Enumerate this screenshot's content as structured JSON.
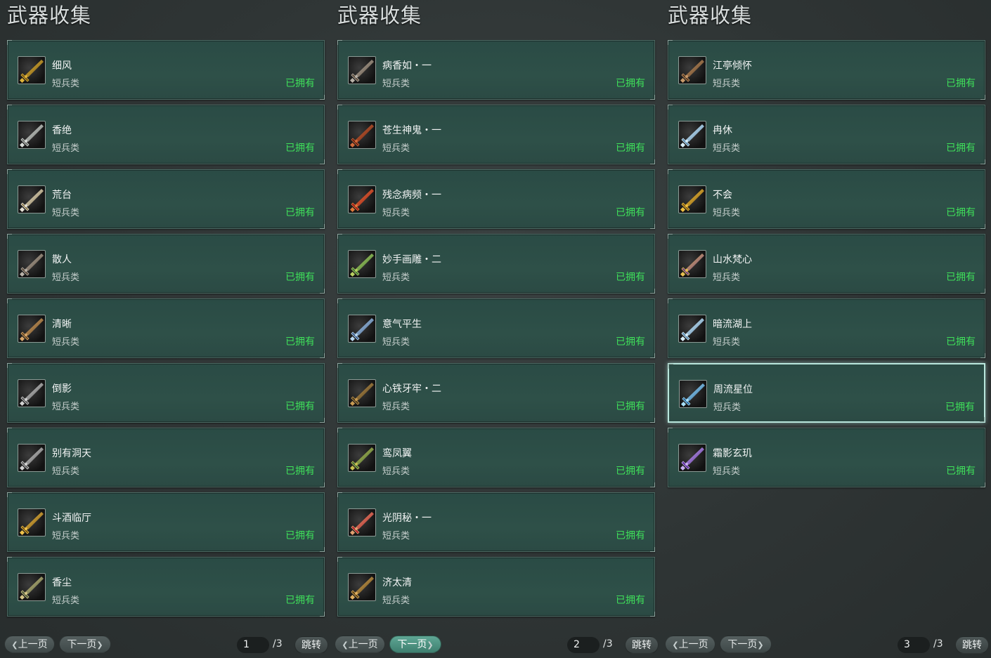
{
  "panels": [
    {
      "title": "武器收集",
      "items": [
        {
          "name": "细风",
          "type": "短兵类",
          "status": "已拥有",
          "icon": "golden-blade-icon"
        },
        {
          "name": "香绝",
          "type": "短兵类",
          "status": "已拥有",
          "icon": "silver-blade-icon"
        },
        {
          "name": "荒台",
          "type": "短兵类",
          "status": "已拥有",
          "icon": "cross-sword-icon"
        },
        {
          "name": "散人",
          "type": "短兵类",
          "status": "已拥有",
          "icon": "dark-sword-icon"
        },
        {
          "name": "清晰",
          "type": "短兵类",
          "status": "已拥有",
          "icon": "bronze-sword-icon"
        },
        {
          "name": "倒影",
          "type": "短兵类",
          "status": "已拥有",
          "icon": "grey-blade-icon"
        },
        {
          "name": "别有洞天",
          "type": "短兵类",
          "status": "已拥有",
          "icon": "grey-blade-icon"
        },
        {
          "name": "斗酒临厅",
          "type": "短兵类",
          "status": "已拥有",
          "icon": "ornate-gold-sword-icon"
        },
        {
          "name": "香尘",
          "type": "短兵类",
          "status": "已拥有",
          "icon": "jeweled-sword-icon"
        }
      ],
      "pager": {
        "prev": "上一页",
        "next": "下一页",
        "page": "1",
        "total": "/3",
        "jump": "跳转"
      }
    },
    {
      "title": "武器收集",
      "items": [
        {
          "name": "病香如・一",
          "type": "短兵类",
          "status": "已拥有",
          "icon": "dark-sword-icon"
        },
        {
          "name": "苍生神鬼・一",
          "type": "短兵类",
          "status": "已拥有",
          "icon": "red-sword-icon"
        },
        {
          "name": "残念病频・一",
          "type": "短兵类",
          "status": "已拥有",
          "icon": "red-gold-sword-icon"
        },
        {
          "name": "妙手画雕・二",
          "type": "短兵类",
          "status": "已拥有",
          "icon": "green-gold-sword-icon"
        },
        {
          "name": "意气平生",
          "type": "短兵类",
          "status": "已拥有",
          "icon": "blue-star-sword-icon"
        },
        {
          "name": "心铁牙牢・二",
          "type": "短兵类",
          "status": "已拥有",
          "icon": "bronze-dagger-icon"
        },
        {
          "name": "鸾凤翼",
          "type": "短兵类",
          "status": "已拥有",
          "icon": "green-dagger-icon"
        },
        {
          "name": "光阴秘・一",
          "type": "短兵类",
          "status": "已拥有",
          "icon": "red-jewel-sword-icon"
        },
        {
          "name": "济太清",
          "type": "短兵类",
          "status": "已拥有",
          "icon": "gold-dagger-icon"
        }
      ],
      "pager": {
        "prev": "上一页",
        "next": "下一页",
        "page": "2",
        "total": "/3",
        "jump": "跳转"
      }
    },
    {
      "title": "武器收集",
      "items": [
        {
          "name": "江亭倾怀",
          "type": "短兵类",
          "status": "已拥有",
          "icon": "wooden-dagger-icon"
        },
        {
          "name": "冉休",
          "type": "短兵类",
          "status": "已拥有",
          "icon": "ice-blade-icon"
        },
        {
          "name": "不会",
          "type": "短兵类",
          "status": "已拥有",
          "icon": "gold-cross-icon"
        },
        {
          "name": "山水梵心",
          "type": "短兵类",
          "status": "已拥有",
          "icon": "gold-purple-sword-icon"
        },
        {
          "name": "暗流湖上",
          "type": "短兵类",
          "status": "已拥有",
          "icon": "ice-blade-icon"
        },
        {
          "name": "周流星位",
          "type": "短兵类",
          "status": "已拥有",
          "icon": "blue-crystal-sword-icon",
          "selected": true
        },
        {
          "name": "霜影玄玑",
          "type": "短兵类",
          "status": "已拥有",
          "icon": "purple-blade-icon"
        }
      ],
      "pager": {
        "prev": "上一页",
        "next": "下一页",
        "page": "3",
        "total": "/3",
        "jump": "跳转"
      }
    }
  ],
  "colors": {
    "owned": "#3fe05a",
    "card": "#2d4d47",
    "background": "#2f3535",
    "active_button": "#4e9483"
  }
}
